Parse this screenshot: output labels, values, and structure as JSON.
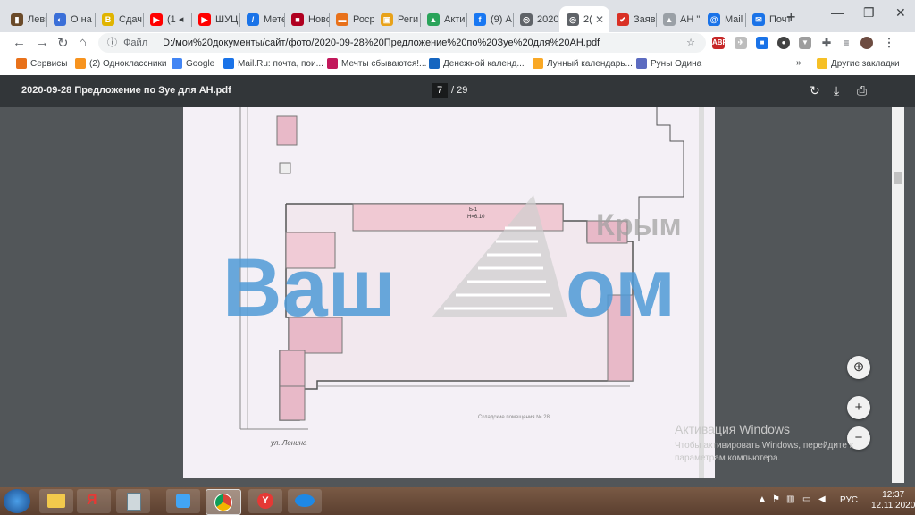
{
  "tabs": [
    {
      "label": "Левы",
      "color": "#6b4b2a",
      "glyph": "▮"
    },
    {
      "label": "О на",
      "color": "#3b6fd8",
      "glyph": "◐"
    },
    {
      "label": "Сдач",
      "color": "#e0b400",
      "glyph": "B"
    },
    {
      "label": "(1 ◂",
      "color": "#ff0000",
      "glyph": "▶"
    },
    {
      "label": "ШУЦ",
      "color": "#ff0000",
      "glyph": "▶"
    },
    {
      "label": "Мете",
      "color": "#1a73e8",
      "glyph": "/"
    },
    {
      "label": "Новс",
      "color": "#b00020",
      "glyph": "■"
    },
    {
      "label": "Роср",
      "color": "#e8711a",
      "glyph": "▬"
    },
    {
      "label": "Реги",
      "color": "#e8a21a",
      "glyph": "▣"
    },
    {
      "label": "Акти",
      "color": "#2aa35a",
      "glyph": "▲"
    },
    {
      "label": "(9) А",
      "color": "#1877f2",
      "glyph": "f"
    },
    {
      "label": "2020",
      "color": "#5f6368",
      "glyph": "◎"
    },
    {
      "label": "2(",
      "color": "#5f6368",
      "glyph": "◎"
    },
    {
      "label": "Заяв",
      "color": "#d93025",
      "glyph": "✔"
    },
    {
      "label": "АН \"",
      "color": "#9aa0a6",
      "glyph": "▲"
    },
    {
      "label": "Mail",
      "color": "#1a73e8",
      "glyph": "@"
    },
    {
      "label": "Почт",
      "color": "#1a73e8",
      "glyph": "✉"
    }
  ],
  "address": "D:/мои%20документы/сайт/фото/2020-09-28%20Предложение%20по%20Зуе%20для%20АН.pdf",
  "address_prefix": "Файл",
  "bookmarks": [
    {
      "label": "Сервисы",
      "color": "#e8711a"
    },
    {
      "label": "(2) Одноклассники",
      "color": "#f7931e"
    },
    {
      "label": "Google",
      "color": "#4285f4"
    },
    {
      "label": "Mail.Ru: почта, пои...",
      "color": "#1a73e8"
    },
    {
      "label": "Мечты сбываются!...",
      "color": "#c2185b"
    },
    {
      "label": "Денежной календ...",
      "color": "#1565c0"
    },
    {
      "label": "Лунный календарь...",
      "color": "#f9a825"
    },
    {
      "label": "Руны Одина",
      "color": "#5c6bc0"
    }
  ],
  "other_bookmarks": "Другие закладки",
  "more_bookmarks": "»",
  "pdf": {
    "title": "2020-09-28 Предложение по Зуе для АН.pdf",
    "page": "7",
    "total": "/ 29"
  },
  "watermark": {
    "left": "Ваш",
    "right": "ом",
    "small": "Крым"
  },
  "plan_labels": {
    "b1": "Б-1",
    "b1h": "H=6.10",
    "street": "ул. Ленина",
    "caption": "Складские помещения № 28"
  },
  "activation": {
    "line1": "Активация Windows",
    "line2": "Чтобы активировать Windows, перейдите к",
    "line3": "параметрам компьютера."
  },
  "clock": {
    "time": "12:37",
    "date": "12.11.2020"
  },
  "lang": "РУС"
}
